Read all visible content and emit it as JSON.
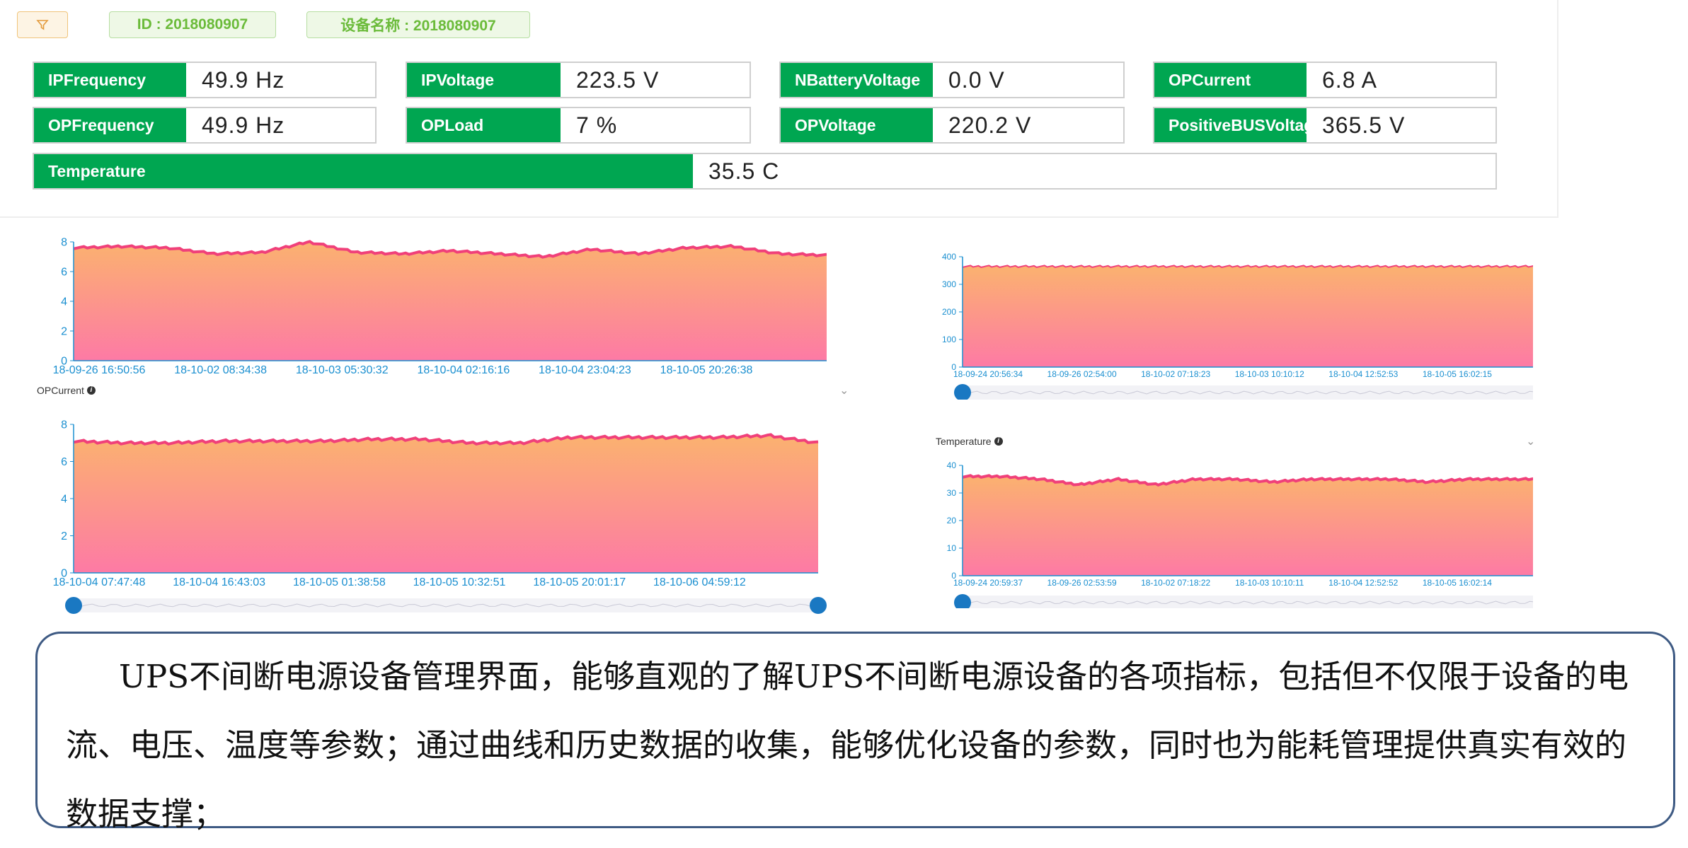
{
  "toolbar": {
    "filter_icon": "filter-icon",
    "id_tag": "ID : 2018080907",
    "device_tag": "设备名称 : 2018080907"
  },
  "metrics": [
    {
      "label": "IPFrequency",
      "value": "49.9 Hz"
    },
    {
      "label": "IPVoltage",
      "value": "223.5 V"
    },
    {
      "label": "NBatteryVoltage",
      "value": "0.0 V"
    },
    {
      "label": "OPCurrent",
      "value": "6.8 A"
    },
    {
      "label": "OPFrequency",
      "value": "49.9 Hz"
    },
    {
      "label": "OPLoad",
      "value": "7 %"
    },
    {
      "label": "OPVoltage",
      "value": "220.2 V"
    },
    {
      "label": "PositiveBUSVoltage",
      "value": "365.5 V"
    },
    {
      "label": "Temperature",
      "value": "35.5 C"
    }
  ],
  "colors": {
    "accent": "#00a651",
    "line": "#f0407a",
    "area_top": "#fbb26f",
    "area_bottom": "#fd7aa5",
    "axis": "#1a8fd0",
    "caption_border": "#3e5a83"
  },
  "charts": {
    "c2_title": "OPCurrent",
    "c4_title": "Temperature"
  },
  "chart_data": [
    {
      "type": "area",
      "title": "",
      "x": [
        "18-09-26 16:50:56",
        "18-10-02 08:34:38",
        "18-10-03 05:30:32",
        "18-10-04 02:16:16",
        "18-10-04 23:04:23",
        "18-10-05 20:26:38"
      ],
      "yticks": [
        "0",
        "2",
        "4",
        "6",
        "8"
      ],
      "ylim": [
        0,
        8
      ],
      "series": [
        {
          "values": [
            7.6,
            7.7,
            7.6,
            7.2,
            7.3,
            8.0,
            7.3,
            7.2,
            7.4,
            7.2,
            7.0,
            7.5,
            7.2,
            7.6,
            7.7,
            7.2,
            7.1
          ]
        }
      ]
    },
    {
      "type": "area",
      "title": "OPCurrent",
      "x": [
        "18-10-04 07:47:48",
        "18-10-04 16:43:03",
        "18-10-05 01:38:58",
        "18-10-05 10:32:51",
        "18-10-05 20:01:17",
        "18-10-06 04:59:12"
      ],
      "yticks": [
        "0",
        "2",
        "4",
        "6",
        "8"
      ],
      "ylim": [
        0,
        8
      ],
      "series": [
        {
          "values": [
            7.1,
            7.0,
            7.0,
            7.1,
            7.1,
            7.1,
            7.2,
            7.2,
            7.0,
            7.0,
            7.3,
            7.3,
            7.3,
            7.3,
            7.4,
            7.0
          ]
        }
      ]
    },
    {
      "type": "area",
      "title": "",
      "x": [
        "18-09-24 20:56:34",
        "18-09-26 02:54:00",
        "18-10-02 07:18:23",
        "18-10-03 10:10:12",
        "18-10-04 12:52:53",
        "18-10-05 16:02:15"
      ],
      "yticks": [
        "0",
        "100",
        "200",
        "300",
        "400"
      ],
      "ylim": [
        0,
        400
      ],
      "series": [
        {
          "values": [
            365,
            365,
            365,
            365,
            365,
            365,
            365,
            365,
            365,
            365
          ]
        }
      ]
    },
    {
      "type": "area",
      "title": "Temperature",
      "x": [
        "18-09-24 20:59:37",
        "18-09-26 02:53:59",
        "18-10-02 07:18:22",
        "18-10-03 10:10:11",
        "18-10-04 12:52:52",
        "18-10-05 16:02:14"
      ],
      "yticks": [
        "0",
        "10",
        "20",
        "30",
        "40"
      ],
      "ylim": [
        0,
        40
      ],
      "series": [
        {
          "values": [
            36,
            36,
            35,
            33,
            35,
            33,
            35,
            35,
            34,
            35,
            35,
            35,
            34,
            35,
            35,
            35
          ]
        }
      ]
    }
  ],
  "caption": "UPS不间断电源设备管理界面，能够直观的了解UPS不间断电源设备的各项指标，包括但不仅限于设备的电流、电压、温度等参数；通过曲线和历史数据的收集，能够优化设备的参数，同时也为能耗管理提供真实有效的数据支撑；"
}
